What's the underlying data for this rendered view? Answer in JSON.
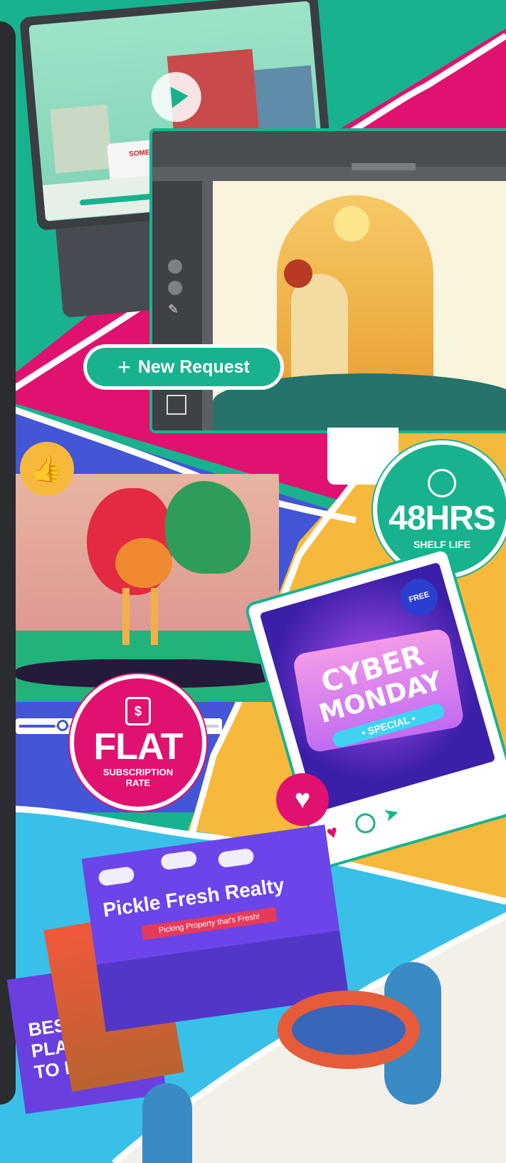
{
  "new_request": {
    "label": "New Request",
    "icon": "plus-icon"
  },
  "badge_shelf": {
    "big": "48HRS",
    "small": "SHELF LIFE",
    "icon": "stopwatch-icon"
  },
  "badge_flat": {
    "big": "FLAT",
    "small_1": "SUBSCRIPTION",
    "small_2": "RATE",
    "icon": "dollar-lock-icon"
  },
  "cyber_card": {
    "line1": "CYBER",
    "line2": "MONDAY",
    "line3": "• SPECIAL •",
    "corner": "FREE"
  },
  "realty": {
    "title": "Pickle Fresh Realty",
    "tagline": "Picking Property that's Fresh!",
    "side_text": "BEST PLAC TO L"
  },
  "video": {
    "van_text": "SOMETHING"
  },
  "colors": {
    "teal": "#19b28e",
    "magenta": "#e1116f",
    "yellow": "#f7b93b",
    "blue": "#4256d6",
    "sky": "#39c0e8",
    "purple": "#7a3df0"
  }
}
